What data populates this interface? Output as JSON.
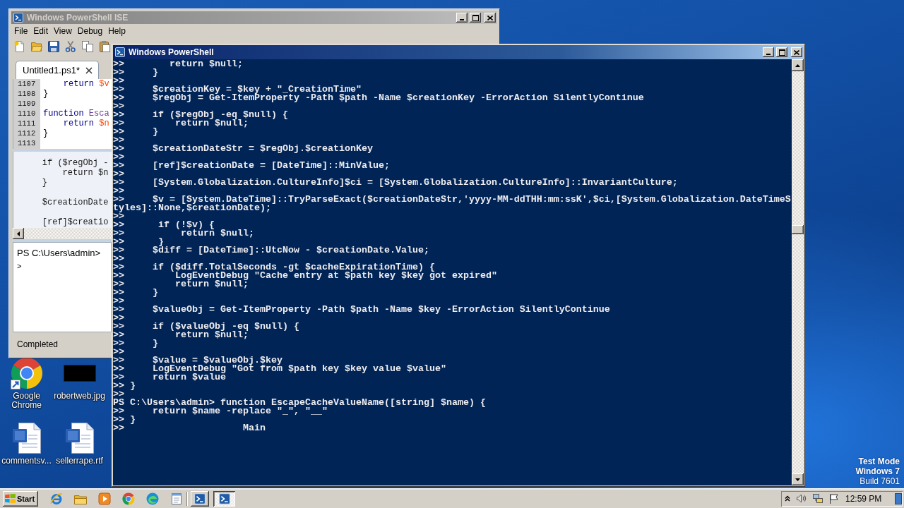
{
  "ise_window": {
    "title": "Windows PowerShell ISE",
    "active": false,
    "menu": [
      "File",
      "Edit",
      "View",
      "Debug",
      "Help"
    ],
    "tabs": [
      {
        "label": "Untitled1.ps1*",
        "selected": true
      }
    ],
    "editor": {
      "lines": [
        {
          "number": "1107",
          "tokens": [
            {
              "kind": "keyword",
              "text": "    return"
            },
            {
              "kind": "variable",
              "text": " $v"
            }
          ]
        },
        {
          "number": "1108",
          "tokens": [
            {
              "kind": "plain",
              "text": "}"
            }
          ]
        },
        {
          "number": "1109"
        },
        {
          "number": "1110",
          "tokens": [
            {
              "kind": "keyword",
              "text": "function"
            },
            {
              "kind": "command",
              "text": " Esca"
            }
          ]
        },
        {
          "number": "1111",
          "tokens": [
            {
              "kind": "keyword",
              "text": "    return"
            },
            {
              "kind": "variable",
              "text": " $n"
            }
          ]
        },
        {
          "number": "1112",
          "tokens": [
            {
              "kind": "plain",
              "text": "}"
            }
          ]
        },
        {
          "number": "1113"
        }
      ]
    },
    "output_pane": {
      "blocks": [
        [
          "    if ($regObj -",
          "        return $n",
          "    }"
        ],
        [
          "    $creationDate"
        ],
        [
          "    [ref]$creatio"
        ]
      ]
    },
    "command_pane": {
      "prompt": "PS C:\\Users\\admin>",
      "input_marker": ">"
    },
    "status_bar": "Completed"
  },
  "console_window": {
    "title": "Windows PowerShell",
    "active": true,
    "lines": [
      ">>        return $null;",
      ">>     }",
      ">>",
      ">>     $creationKey = $key + \"_CreationTime\"",
      ">>     $regObj = Get-ItemProperty -Path $path -Name $creationKey -ErrorAction SilentlyContinue",
      ">>",
      ">>     if ($regObj -eq $null) {",
      ">>         return $null;",
      ">>     }",
      ">>",
      ">>     $creationDateStr = $regObj.$creationKey",
      ">>",
      ">>     [ref]$creationDate = [DateTime]::MinValue;",
      ">>",
      ">>     [System.Globalization.CultureInfo]$ci = [System.Globalization.CultureInfo]::InvariantCulture;",
      ">>",
      ">>     $v = [System.DateTime]::TryParseExact($creationDateStr,'yyyy-MM-ddTHH:mm:ssK',$ci,[System.Globalization.DateTimeS",
      "tyles]::None,$creationDate);",
      ">>",
      ">>      if (!$v) {",
      ">>          return $null;",
      ">>      }",
      ">>     $diff = [DateTime]::UtcNow - $creationDate.Value;",
      ">>",
      ">>     if ($diff.TotalSeconds -gt $cacheExpirationTime) {",
      ">>         LogEventDebug \"Cache entry at $path key $key got expired\"",
      ">>         return $null;",
      ">>     }",
      ">>",
      ">>     $valueObj = Get-ItemProperty -Path $path -Name $key -ErrorAction SilentlyContinue",
      ">>",
      ">>     if ($valueObj -eq $null) {",
      ">>         return $null;",
      ">>     }",
      ">>",
      ">>     $value = $valueObj.$key",
      ">>     LogEventDebug \"Got from $path key $key value $value\"",
      ">>     return $value",
      ">> }",
      ">>",
      "PS C:\\Users\\admin> function EscapeCacheValueName([string] $name) {",
      ">>     return $name -replace \"_\", \"__\"",
      ">> }",
      ">>                     Main"
    ]
  },
  "desktop_icons": [
    {
      "kind": "shortcut",
      "label": "Google Chrome"
    },
    {
      "kind": "image",
      "label": "robertweb.jpg"
    },
    {
      "kind": "document",
      "label": "commentsv..."
    },
    {
      "kind": "document",
      "label": "sellerrape.rtf"
    }
  ],
  "os_notice": [
    {
      "text": "Test Mode",
      "bold": true
    },
    {
      "text": "Windows 7",
      "bold": true
    },
    {
      "text": "Build 7601",
      "bold": false
    }
  ],
  "taskbar": {
    "start": "Start",
    "windows": [
      {
        "selected": false
      },
      {
        "selected": true
      }
    ],
    "clock": "12:59 PM"
  }
}
